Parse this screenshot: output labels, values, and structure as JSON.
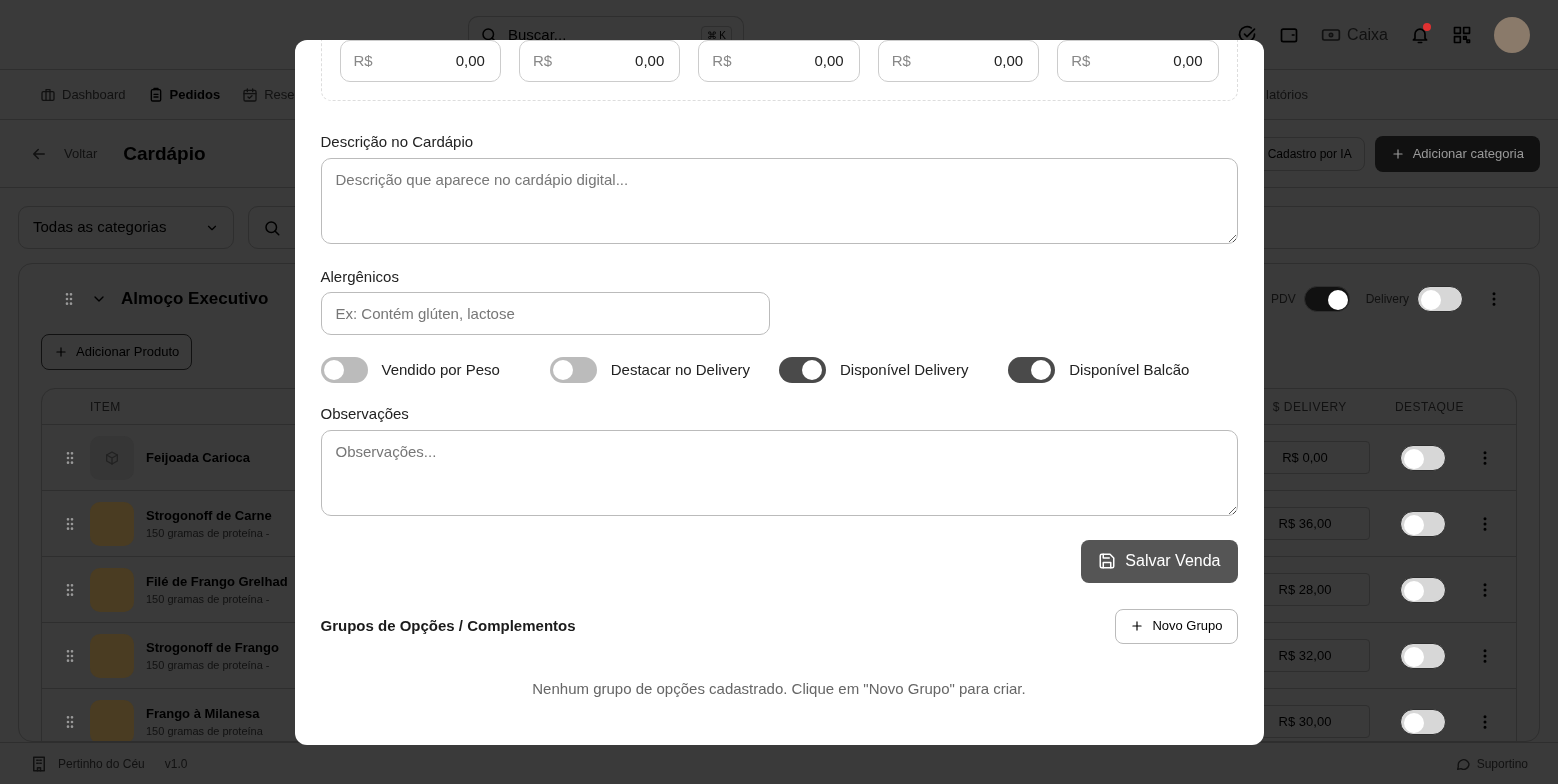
{
  "header": {
    "search_placeholder": "Buscar...",
    "shortcut": "⌘ K",
    "cash_label": "Caixa",
    "notification_dot": true
  },
  "nav": [
    {
      "label": "Dashboard",
      "selected": false
    },
    {
      "label": "Pedidos",
      "selected": true
    },
    {
      "label": "Rese",
      "selected": false
    },
    {
      "label": "latórios",
      "selected": false
    }
  ],
  "page": {
    "back": "Voltar",
    "title": "Cardápio",
    "ai_button": "Cadastro por IA",
    "add_category": "Adicionar categoria"
  },
  "filters": {
    "category": "Todas as categorias"
  },
  "category": {
    "name": "Almoço Executivo",
    "expanded": true,
    "pdv_label": "PDV",
    "pdv_on": true,
    "delivery_label": "Delivery",
    "delivery_on": false,
    "add_product": "Adicionar Produto"
  },
  "table": {
    "columns": [
      "ITEM",
      "$ DELIVERY",
      "DESTAQUE"
    ],
    "rows": [
      {
        "name": "Feijoada Carioca",
        "description": "",
        "has_photo": false,
        "delivery_price": "R$ 0,00",
        "featured": false
      },
      {
        "name": "Strogonoff de Carne",
        "description": "150 gramas de proteína -",
        "has_photo": true,
        "delivery_price": "R$ 36,00",
        "featured": false
      },
      {
        "name": "Filé de Frango Grelhad",
        "description": "150 gramas de proteína -",
        "has_photo": true,
        "delivery_price": "R$ 28,00",
        "featured": false
      },
      {
        "name": "Strogonoff de Frango",
        "description": "150 gramas de proteína -",
        "has_photo": true,
        "delivery_price": "R$ 32,00",
        "featured": false
      },
      {
        "name": "Frango à Milanesa",
        "description": "150 gramas de proteína",
        "has_photo": true,
        "delivery_price": "R$ 30,00",
        "featured": false
      }
    ]
  },
  "footer": {
    "store": "Pertinho do Céu",
    "version": "v1.0",
    "support": "Suportino"
  },
  "modal": {
    "prices": [
      {
        "prefix": "R$",
        "value": "0,00"
      },
      {
        "prefix": "R$",
        "value": "0,00"
      },
      {
        "prefix": "R$",
        "value": "0,00"
      },
      {
        "prefix": "R$",
        "value": "0,00"
      },
      {
        "prefix": "R$",
        "value": "0,00"
      }
    ],
    "description": {
      "label": "Descrição no Cardápio",
      "placeholder": "Descrição que aparece no cardápio digital..."
    },
    "allergens": {
      "label": "Alergênicos",
      "placeholder": "Ex: Contém glúten, lactose"
    },
    "toggles": [
      {
        "label": "Vendido por Peso",
        "on": false
      },
      {
        "label": "Destacar no Delivery",
        "on": false
      },
      {
        "label": "Disponível Delivery",
        "on": true
      },
      {
        "label": "Disponível Balcão",
        "on": true
      }
    ],
    "notes": {
      "label": "Observações",
      "placeholder": "Observações..."
    },
    "save_button": "Salvar Venda",
    "groups": {
      "title": "Grupos de Opções / Complementos",
      "button": "Novo Grupo",
      "empty": "Nenhum grupo de opções cadastrado. Clique em \"Novo Grupo\" para criar."
    }
  }
}
